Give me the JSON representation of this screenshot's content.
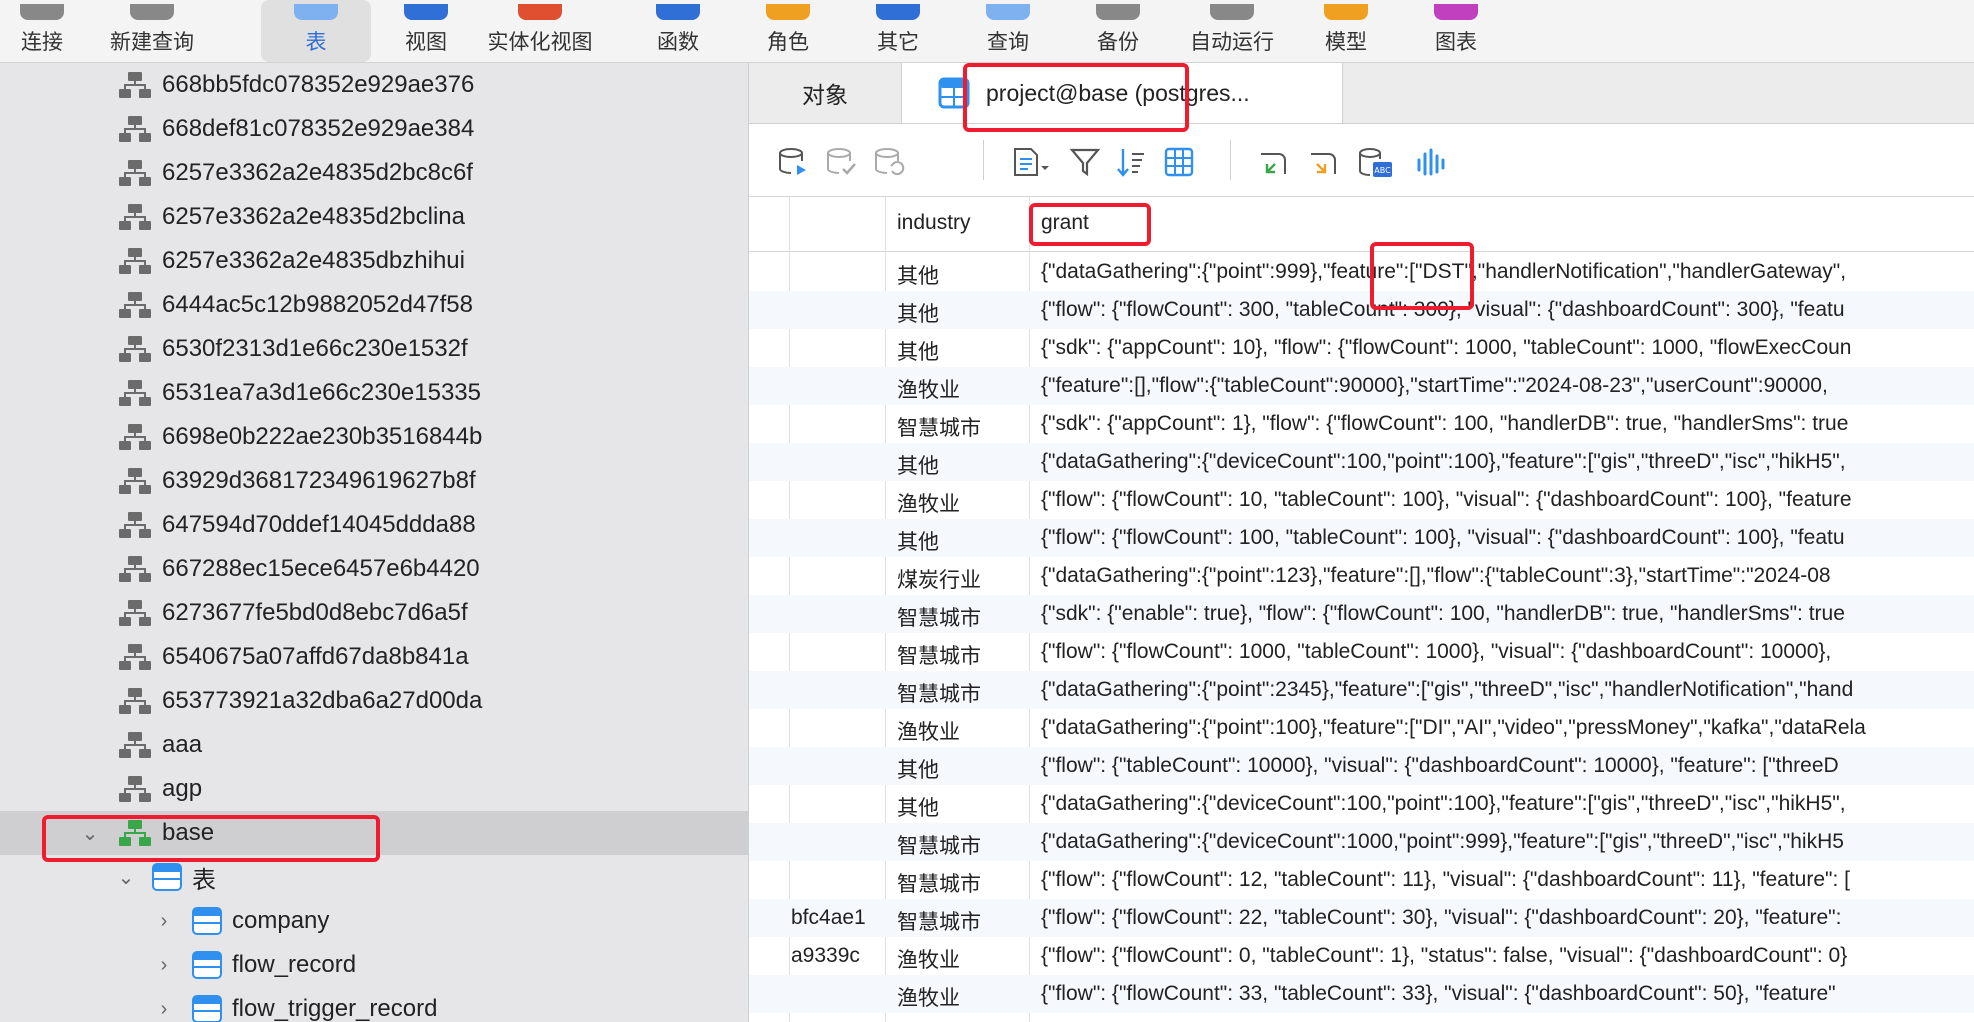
{
  "toolbar": {
    "items": [
      {
        "label": "连接",
        "icon": "connection-icon"
      },
      {
        "label": "新建查询",
        "icon": "new-query-icon"
      },
      {
        "label": "表",
        "icon": "table-icon"
      },
      {
        "label": "视图",
        "icon": "view-icon"
      },
      {
        "label": "实体化视图",
        "icon": "materialized-view-icon"
      },
      {
        "label": "函数",
        "icon": "function-icon"
      },
      {
        "label": "角色",
        "icon": "role-icon"
      },
      {
        "label": "其它",
        "icon": "other-icon"
      },
      {
        "label": "查询",
        "icon": "query-icon"
      },
      {
        "label": "备份",
        "icon": "backup-icon"
      },
      {
        "label": "自动运行",
        "icon": "automation-icon"
      },
      {
        "label": "模型",
        "icon": "model-icon"
      },
      {
        "label": "图表",
        "icon": "chart-icon"
      }
    ],
    "active": "表"
  },
  "sidebar": {
    "databases": [
      "668bb5fdc078352e929ae376",
      "668def81c078352e929ae384",
      "6257e3362a2e4835d2bc8c6f",
      "6257e3362a2e4835d2bclina",
      "6257e3362a2e4835dbzhihui",
      "6444ac5c12b9882052d47f58",
      "6530f2313d1e66c230e1532f",
      "6531ea7a3d1e66c230e15335",
      "6698e0b222ae230b3516844b",
      "63929d368172349619627b8f",
      "647594d70ddef14045ddda88",
      "667288ec15ece6457e6b4420",
      "6273677fe5bd0d8ebc7d6a5f",
      "6540675a07affd67da8b841a",
      "653773921a32dba6a27d00da",
      "aaa",
      "agp"
    ],
    "selected_db": "base",
    "tables_group": "表",
    "tables": [
      "company",
      "flow_record",
      "flow_trigger_record"
    ]
  },
  "tabs": {
    "objects": "对象",
    "query": "project@base (postgres..."
  },
  "grid": {
    "columns": [
      "",
      "industry",
      "grant"
    ],
    "rows": [
      {
        "id": "",
        "industry": "其他",
        "grant": "{\"dataGathering\":{\"point\":999},\"feature\":[\"DST\",\"handlerNotification\",\"handlerGateway\","
      },
      {
        "id": "",
        "industry": "其他",
        "grant": "{\"flow\": {\"flowCount\": 300, \"tableCount\": 300}, \"visual\": {\"dashboardCount\": 300}, \"featu"
      },
      {
        "id": "",
        "industry": "其他",
        "grant": "{\"sdk\": {\"appCount\": 10}, \"flow\": {\"flowCount\": 1000, \"tableCount\": 1000, \"flowExecCoun"
      },
      {
        "id": "",
        "industry": "渔牧业",
        "grant": "{\"feature\":[],\"flow\":{\"tableCount\":90000},\"startTime\":\"2024-08-23\",\"userCount\":90000,"
      },
      {
        "id": "",
        "industry": "智慧城市",
        "grant": "{\"sdk\": {\"appCount\": 1}, \"flow\": {\"flowCount\": 100, \"handlerDB\": true, \"handlerSms\": true"
      },
      {
        "id": "",
        "industry": "其他",
        "grant": "{\"dataGathering\":{\"deviceCount\":100,\"point\":100},\"feature\":[\"gis\",\"threeD\",\"isc\",\"hikH5\","
      },
      {
        "id": "",
        "industry": "渔牧业",
        "grant": "{\"flow\": {\"flowCount\": 10, \"tableCount\": 100}, \"visual\": {\"dashboardCount\": 100}, \"feature"
      },
      {
        "id": "",
        "industry": "其他",
        "grant": "{\"flow\": {\"flowCount\": 100, \"tableCount\": 100}, \"visual\": {\"dashboardCount\": 100}, \"featu"
      },
      {
        "id": "",
        "industry": "煤炭行业",
        "grant": "{\"dataGathering\":{\"point\":123},\"feature\":[],\"flow\":{\"tableCount\":3},\"startTime\":\"2024-08"
      },
      {
        "id": "",
        "industry": "智慧城市",
        "grant": "{\"sdk\": {\"enable\": true}, \"flow\": {\"flowCount\": 100, \"handlerDB\": true, \"handlerSms\": true"
      },
      {
        "id": "",
        "industry": "智慧城市",
        "grant": "{\"flow\": {\"flowCount\": 1000, \"tableCount\": 1000}, \"visual\": {\"dashboardCount\": 10000},"
      },
      {
        "id": "",
        "industry": "智慧城市",
        "grant": "{\"dataGathering\":{\"point\":2345},\"feature\":[\"gis\",\"threeD\",\"isc\",\"handlerNotification\",\"hand"
      },
      {
        "id": "",
        "industry": "渔牧业",
        "grant": "{\"dataGathering\":{\"point\":100},\"feature\":[\"DI\",\"AI\",\"video\",\"pressMoney\",\"kafka\",\"dataRela"
      },
      {
        "id": "",
        "industry": "其他",
        "grant": "{\"flow\": {\"tableCount\": 10000}, \"visual\": {\"dashboardCount\": 10000}, \"feature\": [\"threeD"
      },
      {
        "id": "",
        "industry": "其他",
        "grant": "{\"dataGathering\":{\"deviceCount\":100,\"point\":100},\"feature\":[\"gis\",\"threeD\",\"isc\",\"hikH5\","
      },
      {
        "id": "",
        "industry": "智慧城市",
        "grant": "{\"dataGathering\":{\"deviceCount\":1000,\"point\":999},\"feature\":[\"gis\",\"threeD\",\"isc\",\"hikH5"
      },
      {
        "id": "",
        "industry": "智慧城市",
        "grant": "{\"flow\": {\"flowCount\": 12, \"tableCount\": 11}, \"visual\": {\"dashboardCount\": 11}, \"feature\": ["
      },
      {
        "id": "bfc4ae1",
        "industry": "智慧城市",
        "grant": "{\"flow\": {\"flowCount\": 22, \"tableCount\": 30}, \"visual\": {\"dashboardCount\": 20}, \"feature\":"
      },
      {
        "id": "a9339c",
        "industry": "渔牧业",
        "grant": "{\"flow\": {\"flowCount\": 0, \"tableCount\": 1}, \"status\": false, \"visual\": {\"dashboardCount\": 0}"
      },
      {
        "id": "",
        "industry": "渔牧业",
        "grant": "{\"flow\": {\"flowCount\": 33, \"tableCount\": 33}, \"visual\": {\"dashboardCount\": 50}, \"feature\""
      }
    ]
  },
  "colors": {
    "accent": "#2f6fd6",
    "highlight": "#ee1c2e",
    "db_icon": "#6b6b6b",
    "db_icon_active": "#3aa64a"
  }
}
